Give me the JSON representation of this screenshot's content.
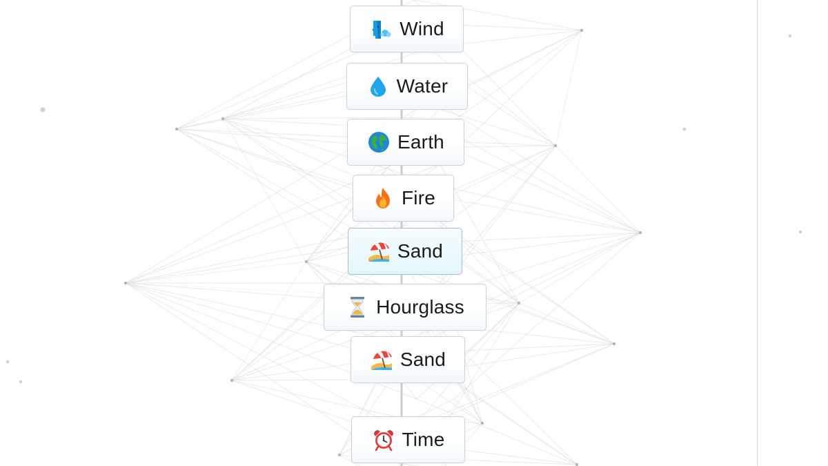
{
  "elements": [
    {
      "text": "Wind",
      "icon": "wind-face-icon"
    },
    {
      "text": "Water",
      "icon": "water-drop-icon"
    },
    {
      "text": "Earth",
      "icon": "globe-icon"
    },
    {
      "text": "Fire",
      "icon": "fire-icon"
    },
    {
      "text": "Sand",
      "icon": "beach-umbrella-icon"
    },
    {
      "text": "Hourglass",
      "icon": "hourglass-icon"
    },
    {
      "text": "Sand",
      "icon": "beach-umbrella-icon"
    },
    {
      "text": "Time",
      "icon": "alarm-clock-icon"
    }
  ],
  "colors": {
    "background": "#ffffff",
    "card_border": "#c8d3e1",
    "selected_card": "#e3f6fd",
    "network_line": "#d9d9d9",
    "network_node": "#b5b5b5"
  }
}
